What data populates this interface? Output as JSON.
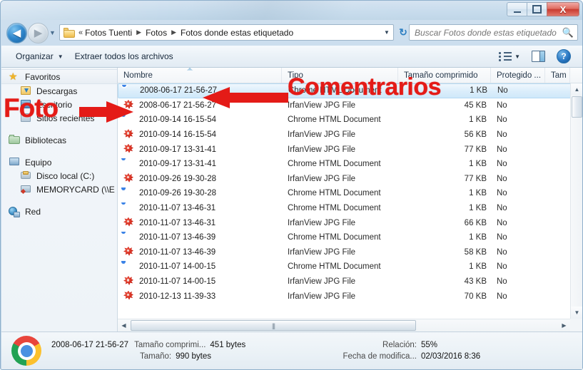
{
  "window": {
    "controls": {
      "minimize_label": "Minimizar",
      "maximize_label": "Maximizar",
      "close_label": "X"
    }
  },
  "addressbar": {
    "back_label": "◀",
    "forward_label": "▶",
    "history_caret": "▼",
    "overflow_chevron": "«",
    "crumbs": [
      "Fotos Tuenti",
      "Fotos",
      "Fotos donde estas etiquetado"
    ],
    "separator": "▶",
    "dropdown_caret": "▼",
    "refresh_label": "↻",
    "folder_icon": "folder-icon"
  },
  "search": {
    "placeholder": "Buscar Fotos donde estas etiquetado",
    "value": "",
    "icon": "search-icon"
  },
  "toolbar": {
    "organizar_label": "Organizar",
    "organizar_caret": "▼",
    "extraer_label": "Extraer todos los archivos",
    "view_caret": "▼",
    "help_label": "?",
    "view_icon": "view-options-icon",
    "pane_icon": "preview-pane-icon",
    "help_icon": "help-icon"
  },
  "navpane": {
    "groups": [
      {
        "header": {
          "label": "Favoritos",
          "icon": "star-icon"
        },
        "items": [
          {
            "label": "Descargas",
            "icon": "downloads-icon"
          },
          {
            "label": "Escritorio",
            "icon": "desktop-icon"
          },
          {
            "label": "Sitios recientes",
            "icon": "recent-places-icon"
          }
        ]
      },
      {
        "header": {
          "label": "Bibliotecas",
          "icon": "libraries-icon"
        },
        "items": []
      },
      {
        "header": {
          "label": "Equipo",
          "icon": "computer-icon"
        },
        "items": [
          {
            "label": "Disco local (C:)",
            "icon": "local-disk-icon"
          },
          {
            "label": "MEMORYCARD (\\\\E",
            "icon": "network-drive-disconnected-icon"
          }
        ]
      },
      {
        "header": {
          "label": "Red",
          "icon": "network-icon"
        },
        "items": []
      }
    ]
  },
  "filelist": {
    "columns": [
      {
        "key": "name",
        "label": "Nombre",
        "sorted": true,
        "sort_dir": "asc"
      },
      {
        "key": "type",
        "label": "Tipo"
      },
      {
        "key": "compressed",
        "label": "Tamaño comprimido"
      },
      {
        "key": "protected",
        "label": "Protegido ..."
      },
      {
        "key": "size",
        "label": "Tam"
      }
    ],
    "rows": [
      {
        "name": "2008-06-17 21-56-27",
        "type": "Chrome HTML Document",
        "compressed": "1 KB",
        "protected": "No",
        "icon": "chrome-file-icon",
        "selected": true
      },
      {
        "name": "2008-06-17 21-56-27",
        "type": "IrfanView JPG File",
        "compressed": "45 KB",
        "protected": "No",
        "icon": "irfanview-file-icon",
        "selected": false
      },
      {
        "name": "2010-09-14 16-15-54",
        "type": "Chrome HTML Document",
        "compressed": "1 KB",
        "protected": "No",
        "icon": "chrome-file-icon",
        "selected": false
      },
      {
        "name": "2010-09-14 16-15-54",
        "type": "IrfanView JPG File",
        "compressed": "56 KB",
        "protected": "No",
        "icon": "irfanview-file-icon",
        "selected": false
      },
      {
        "name": "2010-09-17 13-31-41",
        "type": "IrfanView JPG File",
        "compressed": "77 KB",
        "protected": "No",
        "icon": "irfanview-file-icon",
        "selected": false
      },
      {
        "name": "2010-09-17 13-31-41",
        "type": "Chrome HTML Document",
        "compressed": "1 KB",
        "protected": "No",
        "icon": "chrome-file-icon",
        "selected": false
      },
      {
        "name": "2010-09-26 19-30-28",
        "type": "IrfanView JPG File",
        "compressed": "77 KB",
        "protected": "No",
        "icon": "irfanview-file-icon",
        "selected": false
      },
      {
        "name": "2010-09-26 19-30-28",
        "type": "Chrome HTML Document",
        "compressed": "1 KB",
        "protected": "No",
        "icon": "chrome-file-icon",
        "selected": false
      },
      {
        "name": "2010-11-07 13-46-31",
        "type": "Chrome HTML Document",
        "compressed": "1 KB",
        "protected": "No",
        "icon": "chrome-file-icon",
        "selected": false
      },
      {
        "name": "2010-11-07 13-46-31",
        "type": "IrfanView JPG File",
        "compressed": "66 KB",
        "protected": "No",
        "icon": "irfanview-file-icon",
        "selected": false
      },
      {
        "name": "2010-11-07 13-46-39",
        "type": "Chrome HTML Document",
        "compressed": "1 KB",
        "protected": "No",
        "icon": "chrome-file-icon",
        "selected": false
      },
      {
        "name": "2010-11-07 13-46-39",
        "type": "IrfanView JPG File",
        "compressed": "58 KB",
        "protected": "No",
        "icon": "irfanview-file-icon",
        "selected": false
      },
      {
        "name": "2010-11-07 14-00-15",
        "type": "Chrome HTML Document",
        "compressed": "1 KB",
        "protected": "No",
        "icon": "chrome-file-icon",
        "selected": false
      },
      {
        "name": "2010-11-07 14-00-15",
        "type": "IrfanView JPG File",
        "compressed": "43 KB",
        "protected": "No",
        "icon": "irfanview-file-icon",
        "selected": false
      },
      {
        "name": "2010-12-13 11-39-33",
        "type": "IrfanView JPG File",
        "compressed": "70 KB",
        "protected": "No",
        "icon": "irfanview-file-icon",
        "selected": false
      }
    ],
    "scroll": {
      "up_arrow": "▲",
      "down_arrow": "▼",
      "left_arrow": "◀",
      "right_arrow": "▶",
      "grip": "|||"
    }
  },
  "details": {
    "filename": "2008-06-17 21-56-27",
    "icon": "chrome-file-icon",
    "left": [
      {
        "label": "Tamaño comprimi...",
        "value": "451 bytes"
      },
      {
        "label": "Tamaño:",
        "value": "990 bytes"
      }
    ],
    "right": [
      {
        "label": "Relación:",
        "value": "55%"
      },
      {
        "label": "Fecha de modifica...",
        "value": "02/03/2016 8:36"
      }
    ]
  },
  "annotations": [
    {
      "id": "foto",
      "text": "Foto",
      "color": "#e41b17",
      "arrow_direction": "right"
    },
    {
      "id": "comentarios",
      "text": "Comentrarios",
      "color": "#e41b17",
      "arrow_direction": "left"
    }
  ]
}
